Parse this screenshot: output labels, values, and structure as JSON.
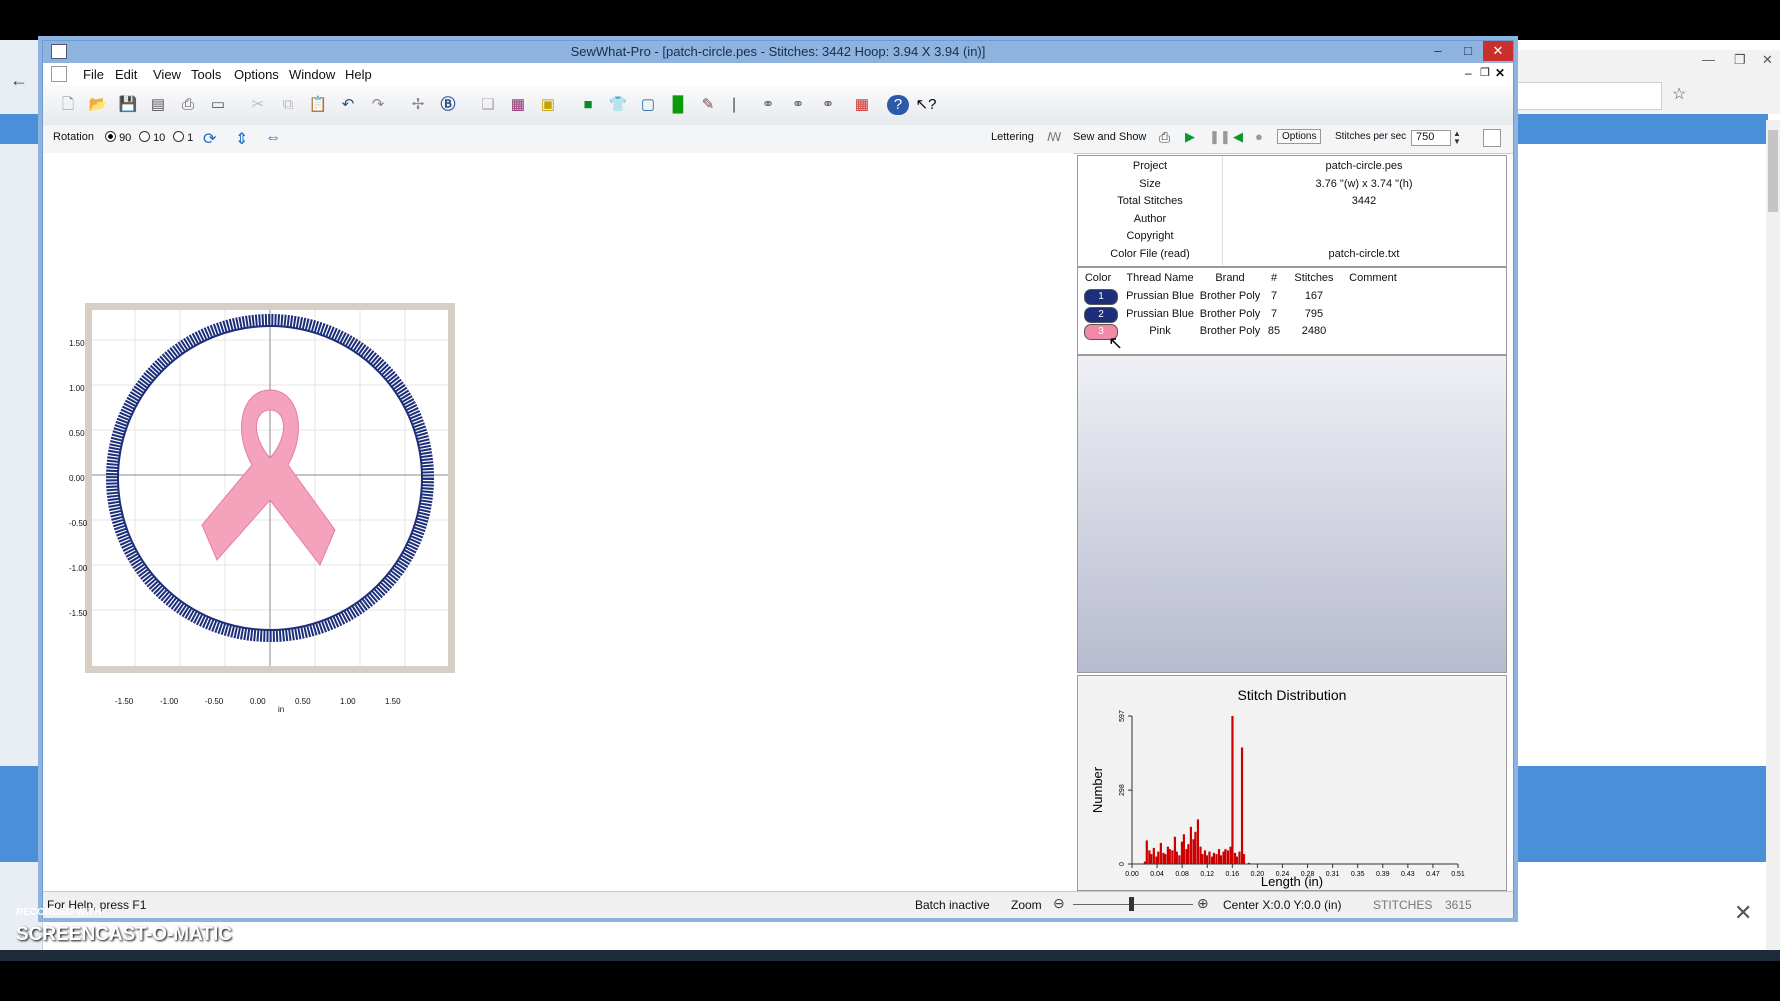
{
  "app": {
    "title": "SewWhat-Pro - [patch-circle.pes - Stitches: 3442  Hoop: 3.94 X 3.94 (in)]"
  },
  "menu": [
    "File",
    "Edit",
    "View",
    "Tools",
    "Options",
    "Window",
    "Help"
  ],
  "toolbar2": {
    "rotation_label": "Rotation",
    "rotation_options": [
      "90",
      "10",
      "1"
    ],
    "rotation_selected": "90",
    "lettering_label": "Lettering",
    "sew_show_label": "Sew and Show",
    "options_label": "Options",
    "stitches_per_sec_label": "Stitches per sec",
    "stitches_per_sec_value": "750"
  },
  "design_axes": {
    "x_ticks": [
      "-1.50",
      "-1.00",
      "-0.50",
      "0.00",
      "0.50",
      "1.00",
      "1.50"
    ],
    "y_ticks": [
      "1.50",
      "1.00",
      "0.50",
      "0.00",
      "-0.50",
      "-1.00",
      "-1.50"
    ],
    "unit": "in"
  },
  "properties": [
    {
      "label": "Project",
      "value": "patch-circle.pes"
    },
    {
      "label": "Size",
      "value": "3.76 \"(w) x 3.74 \"(h)"
    },
    {
      "label": "Total Stitches",
      "value": "3442"
    },
    {
      "label": "Author",
      "value": ""
    },
    {
      "label": "Copyright",
      "value": ""
    },
    {
      "label": "Color File (read)",
      "value": "patch-circle.txt"
    }
  ],
  "threads": {
    "headers": [
      "Color",
      "Thread Name",
      "Brand",
      "#",
      "Stitches",
      "Comment"
    ],
    "rows": [
      {
        "index": "1",
        "name": "Prussian Blue",
        "brand": "Brother Poly",
        "num": "7",
        "stitches": "167",
        "comment": "",
        "color": "#1d2f7a"
      },
      {
        "index": "2",
        "name": "Prussian Blue",
        "brand": "Brother Poly",
        "num": "7",
        "stitches": "795",
        "comment": "",
        "color": "#1d2f7a"
      },
      {
        "index": "3",
        "name": "Pink",
        "brand": "Brother Poly",
        "num": "85",
        "stitches": "2480",
        "comment": "",
        "color": "#f08aa8"
      }
    ]
  },
  "chart_data": {
    "type": "bar",
    "title": "Stitch Distribution",
    "xlabel": "Length (in)",
    "ylabel": "Number",
    "x_ticks": [
      "0.00",
      "0.04",
      "0.08",
      "0.12",
      "0.16",
      "0.20",
      "0.24",
      "0.28",
      "0.31",
      "0.35",
      "0.39",
      "0.43",
      "0.47",
      "0.51"
    ],
    "y_ticks": [
      "0",
      "298",
      "597"
    ],
    "ylim": [
      0,
      597
    ],
    "xlim": [
      0,
      0.51
    ],
    "color": "#cc0000",
    "x": [
      0.02,
      0.023,
      0.027,
      0.03,
      0.034,
      0.038,
      0.041,
      0.045,
      0.049,
      0.052,
      0.056,
      0.059,
      0.063,
      0.067,
      0.07,
      0.074,
      0.078,
      0.081,
      0.085,
      0.088,
      0.092,
      0.096,
      0.099,
      0.103,
      0.107,
      0.11,
      0.114,
      0.117,
      0.121,
      0.125,
      0.128,
      0.132,
      0.136,
      0.139,
      0.143,
      0.146,
      0.15,
      0.154,
      0.157,
      0.161,
      0.164,
      0.168,
      0.172,
      0.175,
      0.179,
      0.183,
      0.186
    ],
    "values": [
      10,
      95,
      55,
      40,
      65,
      30,
      50,
      85,
      45,
      40,
      70,
      60,
      55,
      110,
      50,
      35,
      90,
      120,
      60,
      80,
      150,
      100,
      130,
      180,
      70,
      40,
      55,
      35,
      50,
      30,
      45,
      40,
      60,
      35,
      50,
      60,
      55,
      70,
      597,
      45,
      30,
      50,
      470,
      40,
      0,
      5,
      0
    ]
  },
  "status": {
    "help": "For Help, press F1",
    "batch": "Batch inactive",
    "zoom_label": "Zoom",
    "center": "Center X:0.0  Y:0.0 (in)",
    "stitches_label": "STITCHES",
    "stitches_value": "3615"
  },
  "watermark": {
    "small": "RECORDED WITH",
    "brand": "SCREENCAST-O-MATIC"
  }
}
